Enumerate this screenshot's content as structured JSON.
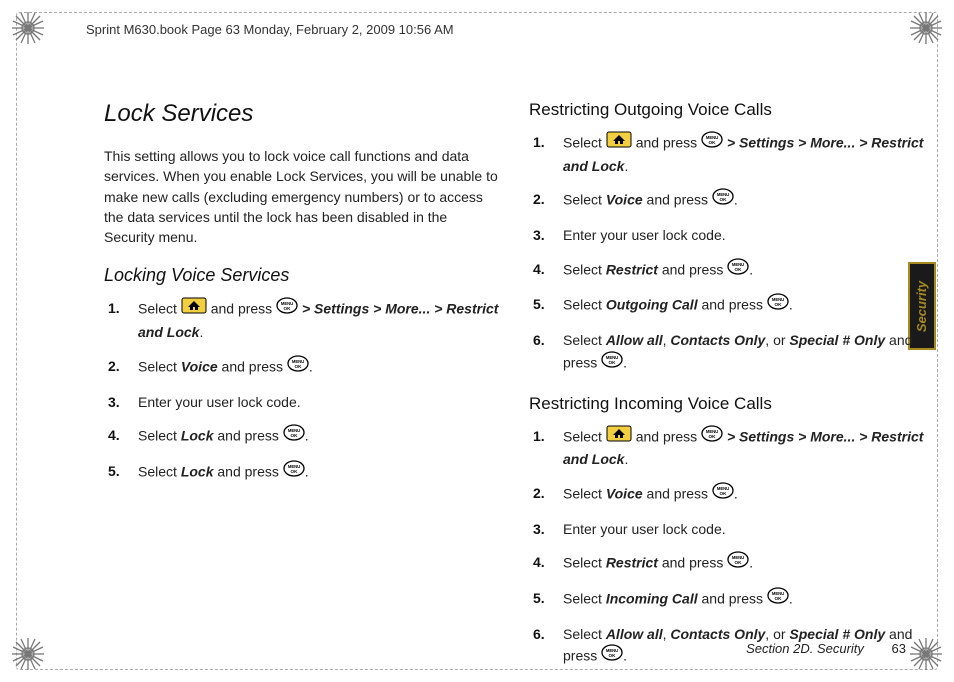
{
  "header_line": "Sprint M630.book  Page 63  Monday, February 2, 2009  10:56 AM",
  "thumb_tab": "Security",
  "footer": {
    "section": "Section 2D. Security",
    "page": "63"
  },
  "left": {
    "title": "Lock Services",
    "intro": "This setting allows you to lock voice call functions and data services. When you enable Lock Services, you will be unable to make new calls (excluding emergency numbers) or to access the data services until the lock has been disabled in the Security menu.",
    "sub1": "Locking Voice Services",
    "s1_path": " > Settings > More... > Restrict and Lock",
    "s2_a": "Select ",
    "s2_b": "Voice",
    "s2_c": " and press ",
    "s3": "Enter your user lock code.",
    "s4_a": "Select ",
    "s4_b": "Lock",
    "s4_c": " and press ",
    "s5_a": "Select ",
    "s5_b": "Lock",
    "s5_c": " and press "
  },
  "right": {
    "h_out": "Restricting Outgoing Voice Calls",
    "o1_path": " > Settings > More... > Restrict and Lock",
    "o2_a": "Select ",
    "o2_b": "Voice",
    "o2_c": " and press ",
    "o3": "Enter your user lock code.",
    "o4_a": "Select ",
    "o4_b": "Restrict",
    "o4_c": " and press ",
    "o5_a": "Select ",
    "o5_b": "Outgoing Call",
    "o5_c": " and press ",
    "o6_a": "Select ",
    "o6_b": "Allow all",
    "o6_c": ", ",
    "o6_d": "Contacts Only",
    "o6_e": ", or ",
    "o6_f": "Special # Only",
    "o6_g": " and press ",
    "h_in": "Restricting Incoming Voice Calls",
    "i1_path": " > Settings > More... > Restrict and Lock",
    "i2_a": "Select ",
    "i2_b": "Voice",
    "i2_c": " and press ",
    "i3": "Enter your user lock code.",
    "i4_a": "Select ",
    "i4_b": "Restrict",
    "i4_c": " and press ",
    "i5_a": "Select ",
    "i5_b": "Incoming Call",
    "i5_c": " and press ",
    "i6_a": "Select ",
    "i6_b": "Allow all",
    "i6_c": ", ",
    "i6_d": "Contacts Only",
    "i6_e": ", or ",
    "i6_f": "Special # Only",
    "i6_g": " and press "
  },
  "common": {
    "select": "Select ",
    "and_press": " and press ",
    "period": "."
  }
}
